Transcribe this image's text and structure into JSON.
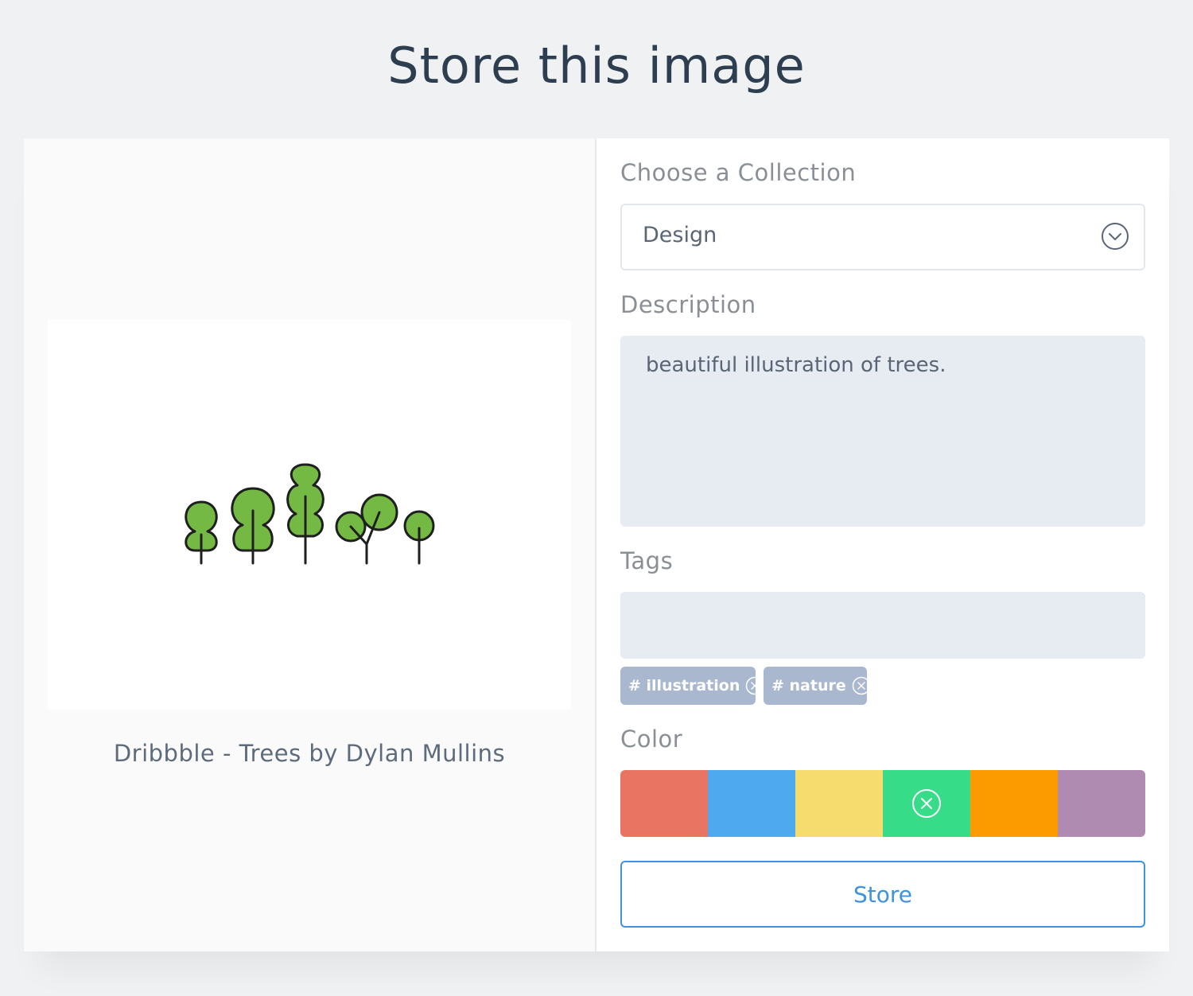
{
  "page": {
    "title": "Store this image"
  },
  "image": {
    "caption": "Dribbble - Trees by Dylan Mullins"
  },
  "form": {
    "collection_label": "Choose a Collection",
    "collection_value": "Design",
    "description_label": "Description",
    "description_value": "beautiful illustration of trees.",
    "tags_label": "Tags",
    "tags_value": "",
    "tags": [
      {
        "label": "# illustration"
      },
      {
        "label": "# nature"
      }
    ],
    "color_label": "Color",
    "colors": [
      {
        "hex": "#e87461",
        "selected": false
      },
      {
        "hex": "#4fa9ef",
        "selected": false
      },
      {
        "hex": "#f6db6f",
        "selected": false
      },
      {
        "hex": "#37dc89",
        "selected": true
      },
      {
        "hex": "#fb9b00",
        "selected": false
      },
      {
        "hex": "#b08bb1",
        "selected": false
      }
    ],
    "store_label": "Store"
  },
  "icons": {
    "select": "chevron-down-circle-icon",
    "tag_remove": "close-circle-icon",
    "color_selected": "close-circle-icon"
  }
}
